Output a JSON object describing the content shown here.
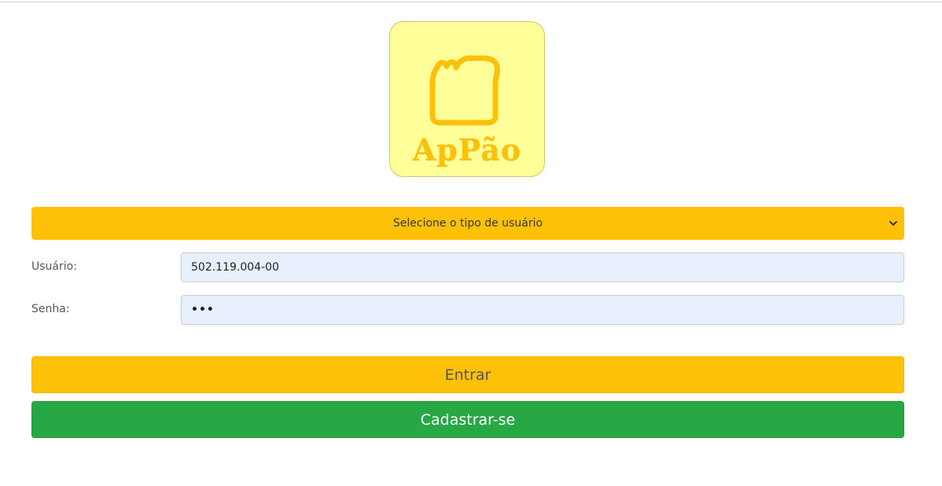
{
  "logo": {
    "icon": "bread-slice-icon",
    "text": "ApPão",
    "background": "#ffff99",
    "accent": "#ffc107"
  },
  "form": {
    "user_type_select": {
      "selected": "Selecione o tipo de usuário",
      "icon": "chevron-down-icon"
    },
    "user_label": "Usuário:",
    "user_value": "502.119.004-00",
    "password_label": "Senha:",
    "password_value": "•••"
  },
  "buttons": {
    "enter_label": "Entrar",
    "register_label": "Cadastrar-se"
  },
  "colors": {
    "primary_yellow": "#ffc107",
    "success_green": "#28a745",
    "input_bg": "#e8f0fe"
  }
}
